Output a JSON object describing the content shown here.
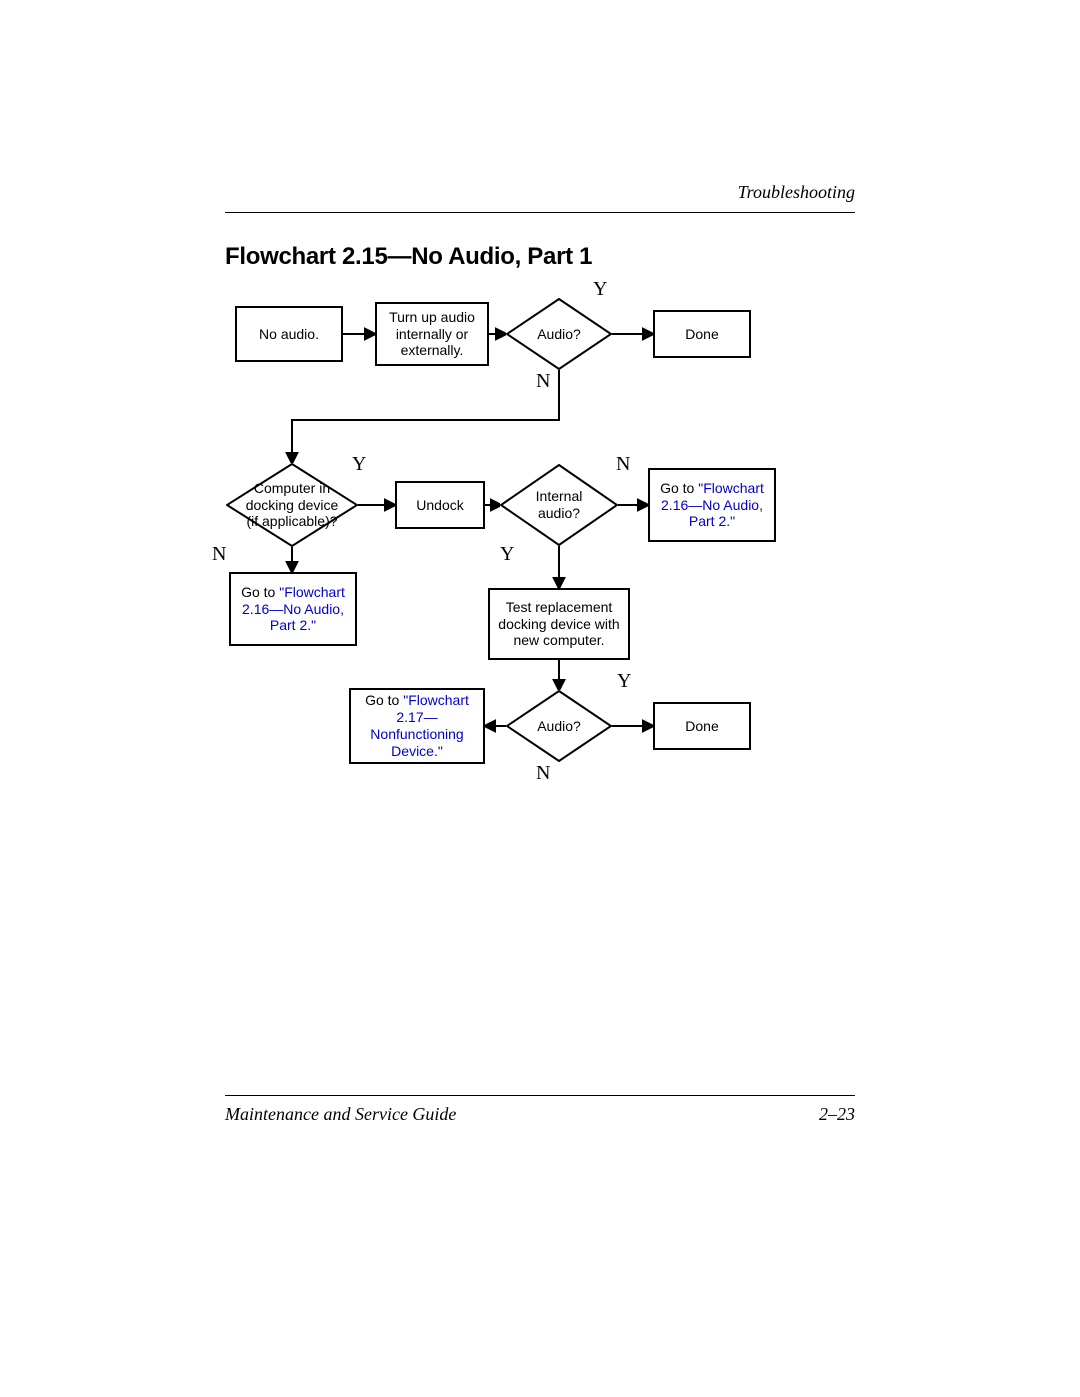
{
  "header": {
    "section": "Troubleshooting"
  },
  "title": "Flowchart 2.15—No Audio, Part 1",
  "footer": {
    "left": "Maintenance and Service Guide",
    "right": "2–23"
  },
  "nodes": {
    "no_audio": "No audio.",
    "turn_up": "Turn up audio internally or externally.",
    "audio1": "Audio?",
    "done1": "Done",
    "docking_q": "Computer in docking device (if applicable)?",
    "undock": "Undock",
    "internal_q": "Internal audio?",
    "goto216a_pre": "Go to ",
    "goto216a_link": "\"Flowchart 2.16—No Audio, Part 2.\"",
    "goto216b_pre": "Go to ",
    "goto216b_link": "\"Flowchart 2.16—No Audio, Part 2.\"",
    "test_repl": "Test replacement docking device with new computer.",
    "goto217_pre": "Go to ",
    "goto217_link": "\"Flowchart 2.17—Nonfunctioning Device.\"",
    "audio2": "Audio?",
    "done2": "Done"
  },
  "labels": {
    "Y": "Y",
    "N": "N"
  }
}
